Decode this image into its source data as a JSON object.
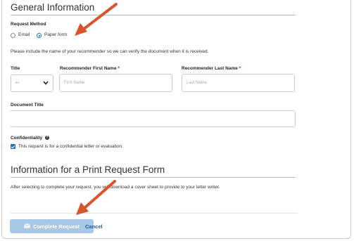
{
  "general": {
    "title": "General Information",
    "request_method_label": "Request Method",
    "options": [
      {
        "label": "Email",
        "selected": false
      },
      {
        "label": "Paper form",
        "selected": true
      }
    ],
    "note": "Please include the name of your recommender so we can verify the document when it is received.",
    "title_label": "Title",
    "title_value": "--",
    "first_name_label": "Recommender First Name",
    "first_name_placeholder": "First Name",
    "last_name_label": "Recommender Last Name",
    "last_name_placeholder": "Last Name",
    "required_mark": "*",
    "document_title_label": "Document Title",
    "confidentiality_label": "Confidentiality",
    "confidential_checkbox_label": "This request is for a confidential letter or evaluation."
  },
  "print": {
    "title": "Information for a Print Request Form",
    "note": "After selecting to complete your request, you will download a cover sheet to provide to your letter writer."
  },
  "actions": {
    "complete_label": "Complete Request",
    "cancel_label": "Cancel"
  },
  "colors": {
    "accent": "#1e73be",
    "arrow": "#d9532c",
    "button_disabled": "#a8c8e8"
  }
}
